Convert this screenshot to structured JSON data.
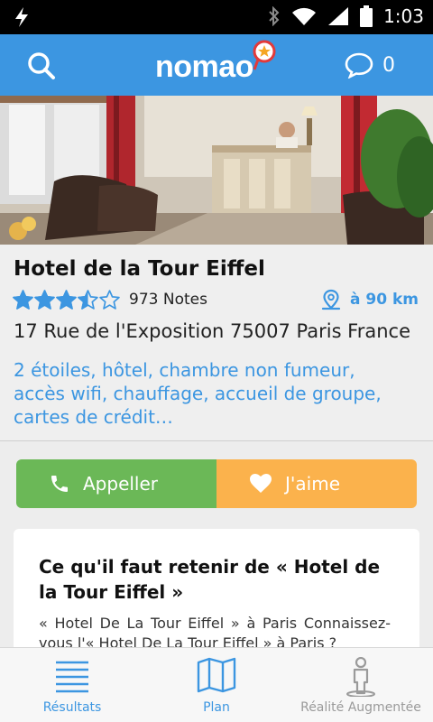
{
  "status_bar": {
    "time": "1:03"
  },
  "app_bar": {
    "logo": "nomao",
    "message_count": "0",
    "icons": [
      "search-icon",
      "message-icon"
    ]
  },
  "hotel": {
    "name": "Hotel de la Tour Eiffel",
    "rating": 3.5,
    "rating_max": 5,
    "notes": "973 Notes",
    "distance": "à 90 km",
    "address": "17 Rue de l'Exposition 75007 Paris France",
    "tags_lines": [
      "2 étoiles, hôtel, chambre non fumeur,",
      "accès wifi, chauffage, accueil de groupe,",
      "cartes de crédit…"
    ]
  },
  "actions": {
    "call_label": "Appeller",
    "like_label": "J'aime"
  },
  "card": {
    "title": "Ce qu'il faut retenir de « Hotel de la Tour Eiffel »",
    "body": "« Hotel De La Tour Eiffel » à Paris Connaissez-vous l'« Hotel De La Tour Eiffel » à Paris ?"
  },
  "bottom_nav": [
    {
      "label": "Résultats",
      "icon": "list-icon"
    },
    {
      "label": "Plan",
      "icon": "map-icon"
    },
    {
      "label": "Réalité Augmentée",
      "icon": "person-icon"
    }
  ],
  "colors": {
    "primary": "#3c96e1",
    "call": "#6bb857",
    "like": "#fbb24c"
  }
}
